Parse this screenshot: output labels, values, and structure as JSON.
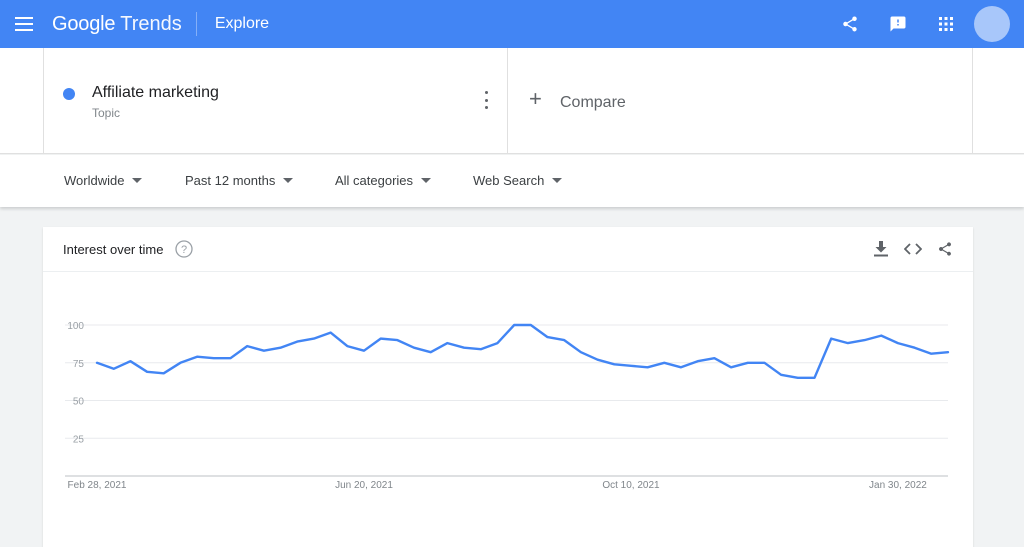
{
  "header": {
    "logo_google": "Google",
    "logo_trends": "Trends",
    "page_title": "Explore",
    "colors": {
      "bar": "#4285f4"
    },
    "icons": [
      "menu-icon",
      "share-icon",
      "feedback-icon",
      "apps-grid-icon"
    ]
  },
  "term": {
    "name": "Affiliate marketing",
    "type": "Topic",
    "color": "#4285f4"
  },
  "compare": {
    "plus": "+",
    "label": "Compare"
  },
  "filters": {
    "region": "Worldwide",
    "time": "Past 12 months",
    "category": "All categories",
    "property": "Web Search"
  },
  "card": {
    "title": "Interest over time",
    "tool_icons": [
      "download-icon",
      "embed-code-icon",
      "share-icon"
    ]
  },
  "chart_data": {
    "type": "line",
    "title": "Interest over time",
    "xlabel": "",
    "ylabel": "",
    "ylim": [
      0,
      100
    ],
    "y_ticks": [
      25,
      50,
      75,
      100
    ],
    "x_tick_labels": [
      "Feb 28, 2021",
      "Jun 20, 2021",
      "Oct 10, 2021",
      "Jan 30, 2022"
    ],
    "x_tick_index": [
      0,
      16,
      32,
      48
    ],
    "grid": true,
    "series": [
      {
        "name": "Affiliate marketing",
        "color": "#4285f4",
        "values": [
          75,
          71,
          76,
          69,
          68,
          75,
          79,
          78,
          78,
          86,
          83,
          85,
          89,
          91,
          95,
          86,
          83,
          91,
          90,
          85,
          82,
          88,
          85,
          84,
          88,
          100,
          100,
          92,
          90,
          82,
          77,
          74,
          73,
          72,
          75,
          72,
          76,
          78,
          72,
          75,
          75,
          67,
          65,
          65,
          91,
          88,
          90,
          93,
          88,
          85,
          81,
          82
        ]
      }
    ]
  }
}
